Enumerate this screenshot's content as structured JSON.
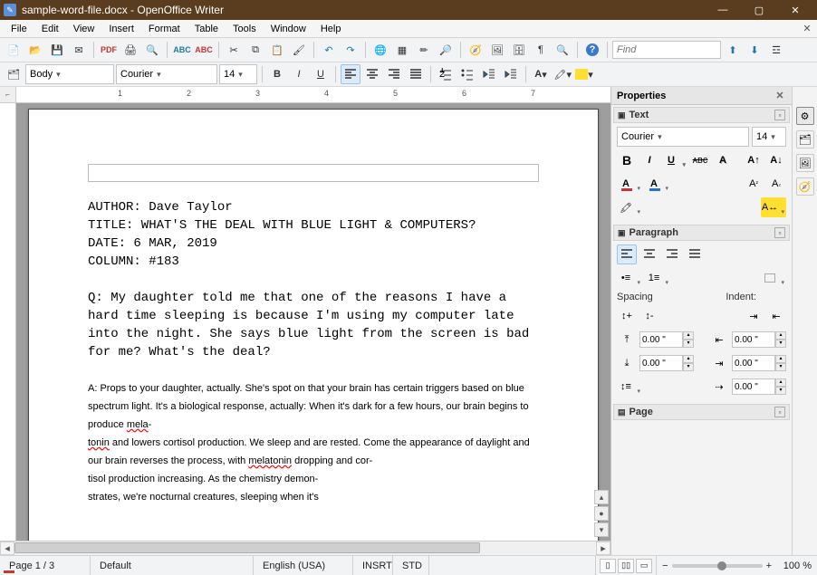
{
  "window": {
    "title": "sample-word-file.docx - OpenOffice Writer"
  },
  "menus": [
    "File",
    "Edit",
    "View",
    "Insert",
    "Format",
    "Table",
    "Tools",
    "Window",
    "Help"
  ],
  "toolbar1": {
    "find_placeholder": "Find"
  },
  "toolbar2": {
    "style_label": "Body",
    "font_label": "Courier",
    "size_label": "14"
  },
  "find": {
    "placeholder": "Find"
  },
  "props": {
    "title": "Properties",
    "text": {
      "title": "Text",
      "font": "Courier",
      "size": "14"
    },
    "para": {
      "title": "Paragraph",
      "spacing_label": "Spacing",
      "indent_label": "Indent:",
      "above": "0.00 \"",
      "below": "0.00 \"",
      "left": "0.00 \"",
      "right": "0.00 \"",
      "firstline": "0.00 \""
    },
    "page": {
      "title": "Page"
    }
  },
  "document": {
    "author": "AUTHOR: Dave Taylor",
    "doctitle": "TITLE: WHAT'S THE DEAL WITH BLUE LIGHT & COMPUTERS?",
    "date": "DATE: 6 MAR, 2019",
    "column": "COLUMN: #183",
    "q": "Q: My daughter told me that one of the reasons I have a hard time sleeping is because I'm using my computer late into the night. She says blue light from the screen is bad for me? What's the deal?",
    "a_pre": "A: Props to your daughter, actually. She's spot on that your brain has certain triggers based on blue spectrum light. It's a biological response, actually: When it's dark for a few hours, our brain begins to produce ",
    "a_mis1": "mela",
    "a_mid1": "-\n",
    "a_mis2": "tonin",
    "a_mid2": " and lowers cortisol production. We sleep and are rested. Come the appearance of daylight and our brain reverses the process, with ",
    "a_mis3": "melatonin",
    "a_post": " dropping and cor-\ntisol production increasing. As the chemistry demon-\nstrates, we're nocturnal creatures, sleeping when it's"
  },
  "ruler": {
    "labels": [
      "1",
      "2",
      "3",
      "4",
      "5",
      "6",
      "7"
    ]
  },
  "status": {
    "page": "Page 1 / 3",
    "style": "Default",
    "lang": "English (USA)",
    "insert": "INSRT",
    "sel": "STD",
    "zoom": "100 %",
    "minus": "−",
    "plus": "+"
  }
}
